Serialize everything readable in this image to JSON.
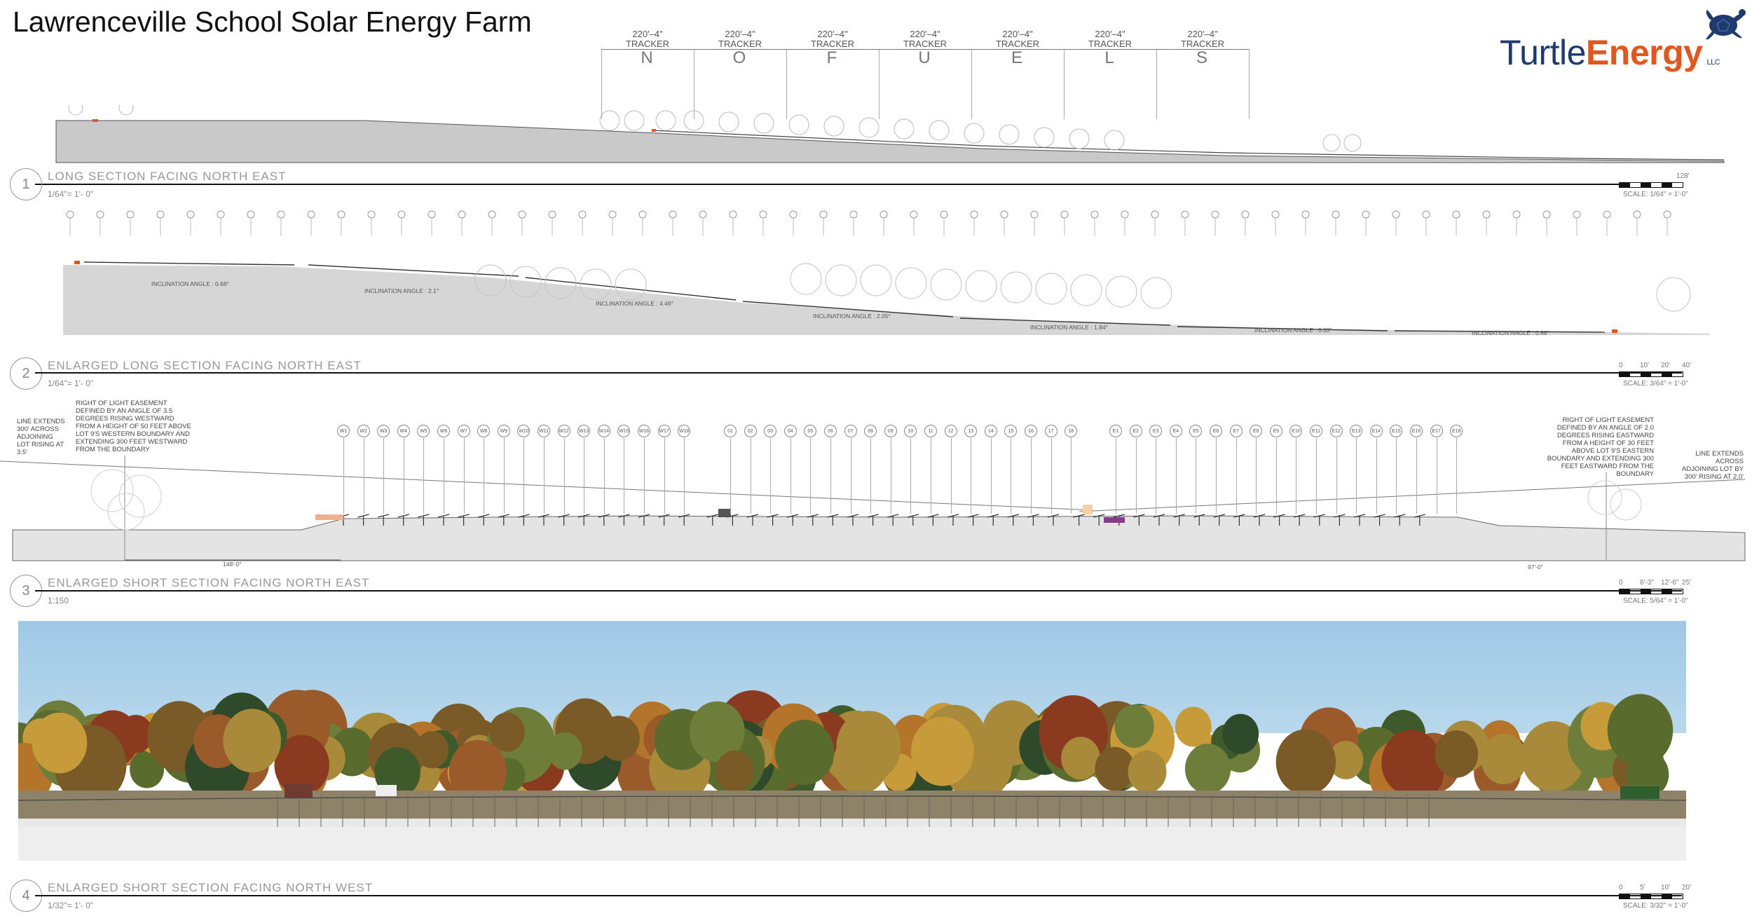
{
  "title": "Lawrenceville School Solar Energy Farm",
  "logo": {
    "part1": "Turtle",
    "part2": "Energy",
    "suffix": "LLC"
  },
  "trackers": [
    {
      "dimension": "220'–4\"",
      "label": "TRACKER",
      "letter": "N"
    },
    {
      "dimension": "220'–4\"",
      "label": "TRACKER",
      "letter": "O"
    },
    {
      "dimension": "220'–4\"",
      "label": "TRACKER",
      "letter": "F"
    },
    {
      "dimension": "220'–4\"",
      "label": "TRACKER",
      "letter": "U"
    },
    {
      "dimension": "220'–4\"",
      "label": "TRACKER",
      "letter": "E"
    },
    {
      "dimension": "220'–4\"",
      "label": "TRACKER",
      "letter": "L"
    },
    {
      "dimension": "220'–4\"",
      "label": "TRACKER",
      "letter": "S"
    }
  ],
  "sections": [
    {
      "number": "1",
      "title": "LONG SECTION FACING NORTH EAST",
      "scale": "1/64\"= 1'- 0\"",
      "bar_scale": "SCALE: 1/64\" = 1'-0\"",
      "bar_end": "128'"
    },
    {
      "number": "2",
      "title": "ENLARGED LONG SECTION FACING NORTH EAST",
      "scale": "1/64\"= 1'- 0\"",
      "bar_scale": "SCALE: 3/64\" = 1'-0\"",
      "bar_ticks": [
        "0",
        "10'",
        "20'",
        "40'"
      ]
    },
    {
      "number": "3",
      "title": "ENLARGED SHORT SECTION FACING NORTH EAST",
      "scale": "1:150",
      "bar_scale": "SCALE: 5/64\" = 1'-0\"",
      "bar_ticks": [
        "0",
        "6'-3\"",
        "12'-6\"",
        "25'"
      ]
    },
    {
      "number": "4",
      "title": "ENLARGED SHORT SECTION FACING NORTH WEST",
      "scale": "1/32\"= 1'- 0\"",
      "bar_scale": "SCALE: 3/32\" = 1'-0\"",
      "bar_ticks": [
        "0",
        "5'",
        "10'",
        "20'"
      ]
    }
  ],
  "inclination_labels": [
    "INCLINATION ANGLE : 0.68°",
    "INCLINATION ANGLE : 2.1°",
    "INCLINATION ANGLE : 4.46°",
    "INCLINATION ANGLE : 2.05°",
    "INCLINATION ANGLE : 1.84°",
    "INCLINATION ANGLE : 0.33°",
    "INCLINATION ANGLE : 0.68°"
  ],
  "west_rows": [
    "W1",
    "W2",
    "W3",
    "W4",
    "W5",
    "W6",
    "W7",
    "W8",
    "W9",
    "W10",
    "W11",
    "W12",
    "W13",
    "W14",
    "W15",
    "W16",
    "W17",
    "W18"
  ],
  "mid_rows": [
    "01",
    "02",
    "03",
    "04",
    "05",
    "06",
    "07",
    "08",
    "09",
    "10",
    "11",
    "12",
    "13",
    "14",
    "15",
    "16",
    "17",
    "18"
  ],
  "east_rows": [
    "E1",
    "E2",
    "E3",
    "E4",
    "E5",
    "E6",
    "E7",
    "E8",
    "E9",
    "E10",
    "E11",
    "E12",
    "E13",
    "E14",
    "E15",
    "E16",
    "E17",
    "E18"
  ],
  "notes": {
    "left_easement": "RIGHT OF LIGHT EASEMENT DEFINED BY AN ANGLE OF 3.5 DEGREES RISING WESTWARD FROM A HEIGHT OF 50 FEET ABOVE LOT 9'S WESTERN BOUNDARY AND EXTENDING 300 FEET WESTWARD FROM THE BOUNDARY",
    "left_line": "LINE EXTENDS 300' ACROSS ADJOINING LOT RISING AT 3.5'",
    "left_dim": "148'-0\"",
    "right_easement": "RIGHT OF LIGHT EASEMENT DEFINED BY AN ANGLE OF 2.0 DEGREES RISING EASTWARD FROM A HEIGHT OF 30 FEET ABOVE LOT 9'S EASTERN BOUNDARY AND EXTENDING 300 FEET EASTWARD FROM THE BOUNDARY",
    "right_line": "LINE EXTENDS ACROSS ADJOINING LOT BY 300' RISING AT 2.0'",
    "right_dim": "97'-0\""
  },
  "colors": {
    "ground": "#d4d4d4",
    "sky": "#a9cfe8",
    "brand_blue": "#1f3b6e",
    "brand_orange": "#e2571e"
  }
}
